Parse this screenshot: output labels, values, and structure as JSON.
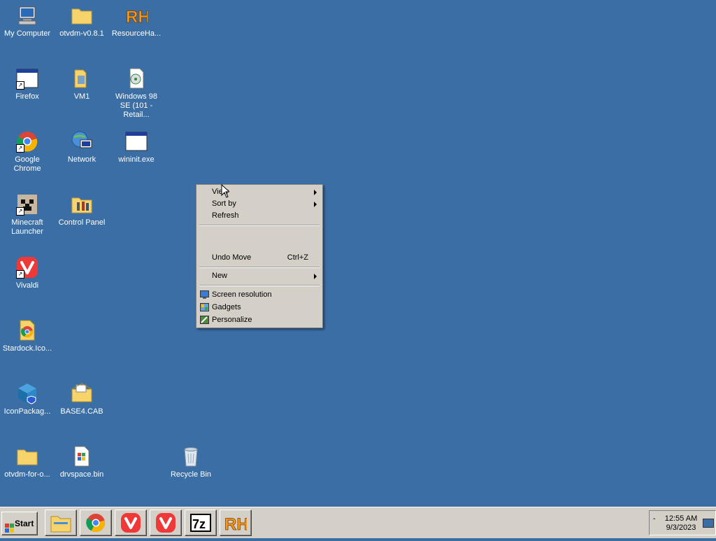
{
  "desktop": {
    "icons": [
      {
        "label": "My Computer",
        "icon": "computer-icon"
      },
      {
        "label": "otvdm-v0.8.1",
        "icon": "folder-icon"
      },
      {
        "label": "ResourceHa...",
        "icon": "resource-hacker-icon"
      },
      {
        "label": "Firefox",
        "icon": "window-app-icon"
      },
      {
        "label": "VM1",
        "icon": "folder-icon"
      },
      {
        "label": "Windows 98 SE (101 - Retail...",
        "icon": "disc-icon"
      },
      {
        "label": "Google Chrome",
        "icon": "chrome-icon"
      },
      {
        "label": "Network",
        "icon": "network-icon"
      },
      {
        "label": "wininit.exe",
        "icon": "window-app-icon"
      },
      {
        "label": "Minecraft Launcher",
        "icon": "minecraft-icon"
      },
      {
        "label": "Control Panel",
        "icon": "control-panel-icon"
      },
      {
        "label": "Vivaldi",
        "icon": "vivaldi-icon"
      },
      {
        "label": "Stardock.Ico...",
        "icon": "chrome-doc-icon"
      },
      {
        "label": "IconPackag...",
        "icon": "iconpackager-icon"
      },
      {
        "label": "BASE4.CAB",
        "icon": "cab-folder-icon"
      },
      {
        "label": "otvdm-for-o...",
        "icon": "folder-icon"
      },
      {
        "label": "drvspace.bin",
        "icon": "windows-file-icon"
      },
      {
        "label": "Recycle Bin",
        "icon": "recycle-bin-icon"
      }
    ]
  },
  "context_menu": {
    "view": "View",
    "sort_by": "Sort by",
    "refresh": "Refresh",
    "undo_move": "Undo Move",
    "undo_shortcut": "Ctrl+Z",
    "new": "New",
    "screen_resolution": "Screen resolution",
    "gadgets": "Gadgets",
    "personalize": "Personalize"
  },
  "taskbar": {
    "start_label": "Start",
    "buttons": [
      "file-explorer-icon",
      "chrome-icon",
      "vivaldi-icon",
      "vivaldi-icon",
      "7zip-icon",
      "resource-hacker-icon"
    ],
    "clock_time": "12:55 AM",
    "clock_date": "9/3/2023"
  },
  "colors": {
    "desktop": "#3a6ea5",
    "menu": "#d4d0c8",
    "taskbar": "#d4d0c8"
  }
}
